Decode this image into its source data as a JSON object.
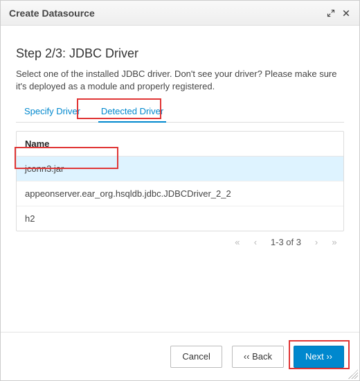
{
  "window": {
    "title": "Create Datasource"
  },
  "step": {
    "heading": "Step 2/3: JDBC Driver",
    "instructions": "Select one of the installed JDBC driver. Don't see your driver? Please make sure it's deployed as a module and properly registered."
  },
  "tabs": {
    "specify": "Specify Driver",
    "detected": "Detected Driver",
    "active_index": 1
  },
  "table": {
    "header": "Name",
    "rows": [
      "jconn3.jar",
      "appeonserver.ear_org.hsqldb.jdbc.JDBCDriver_2_2",
      "h2"
    ],
    "selected_index": 0
  },
  "pager": {
    "first_glyph": "«",
    "prev_glyph": "‹",
    "range": "1-3 of 3",
    "next_glyph": "›",
    "last_glyph": "»"
  },
  "footer": {
    "cancel": "Cancel",
    "back": "‹‹  Back",
    "next": "Next  ››"
  }
}
